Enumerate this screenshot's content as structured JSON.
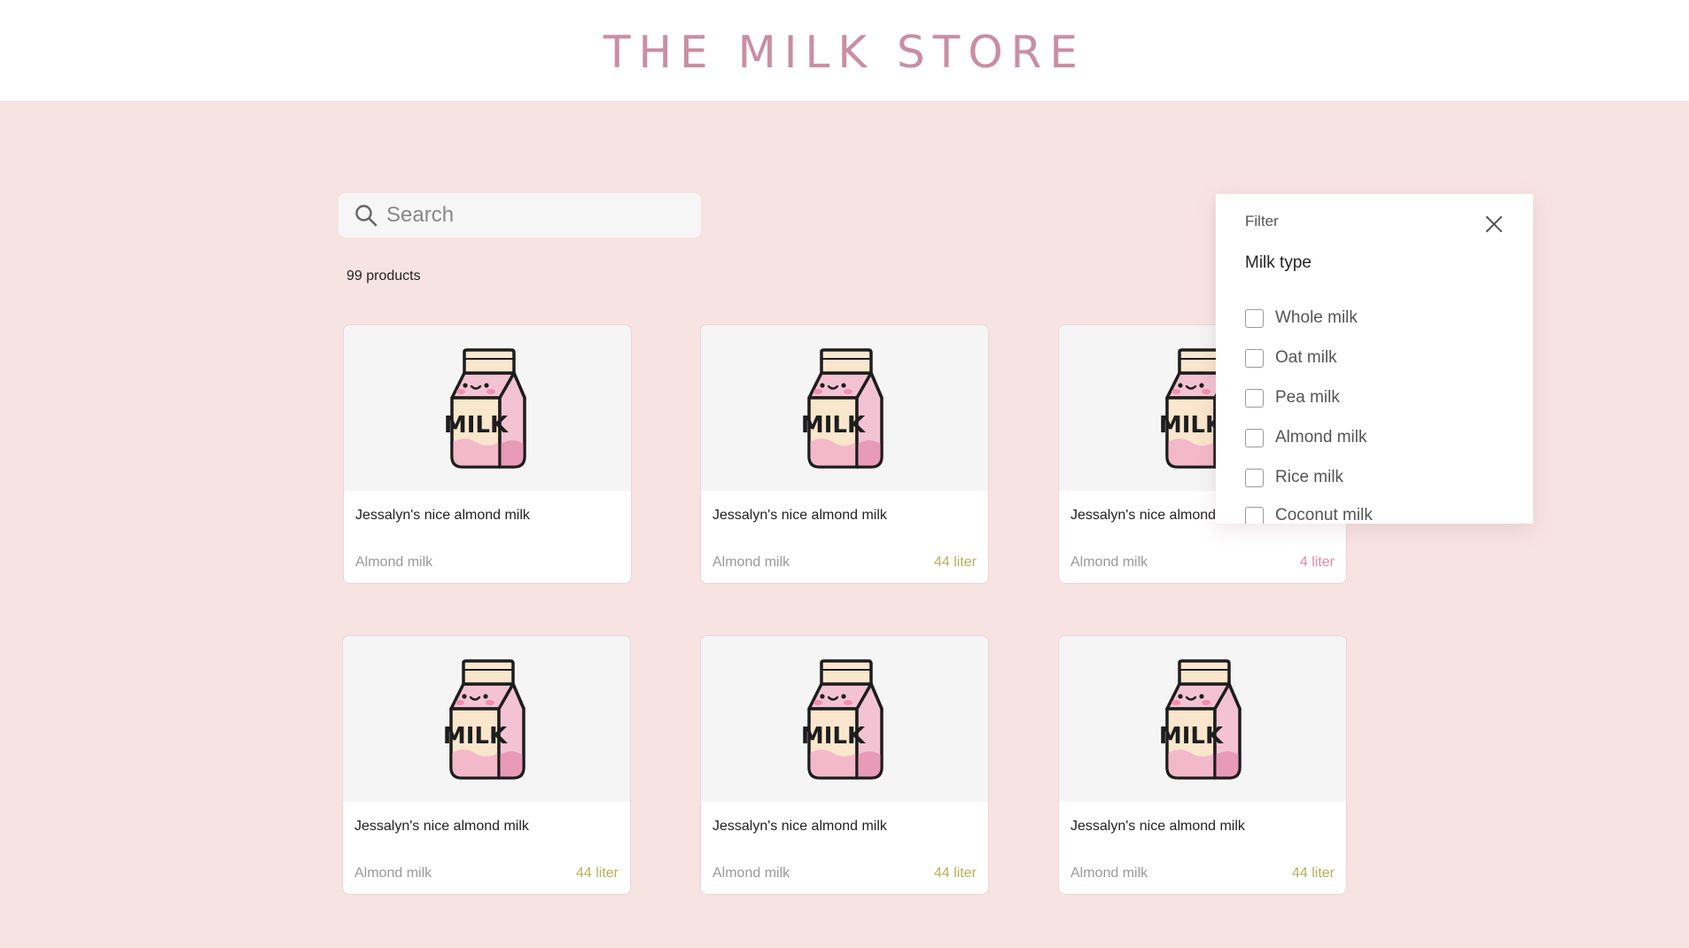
{
  "brand": {
    "title": "THE MILK STORE",
    "color": "#c98ea4"
  },
  "search": {
    "placeholder": "Search",
    "value": ""
  },
  "results": {
    "count_label": "99 products"
  },
  "product_image": {
    "icon": "milk-carton-icon",
    "label": "MILK"
  },
  "products": [
    {
      "name": "Jessalyn's nice almond milk",
      "type": "Almond milk",
      "volume": "",
      "volume_color": ""
    },
    {
      "name": "Jessalyn's nice almond milk",
      "type": "Almond milk",
      "volume": "44 liter",
      "volume_color": "#b3b15a"
    },
    {
      "name": "Jessalyn's nice almond milk",
      "type": "Almond milk",
      "volume": "4 liter",
      "volume_color": "#e08aa2"
    },
    {
      "name": "Jessalyn's nice almond milk",
      "type": "Almond milk",
      "volume": "44 liter",
      "volume_color": "#b3b15a"
    },
    {
      "name": "Jessalyn's nice almond milk",
      "type": "Almond milk",
      "volume": "44 liter",
      "volume_color": "#b3b15a"
    },
    {
      "name": "Jessalyn's nice almond milk",
      "type": "Almond milk",
      "volume": "44 liter",
      "volume_color": "#b3b15a"
    }
  ],
  "filter": {
    "label": "Filter",
    "close_icon": "close-icon",
    "section_title": "Milk type",
    "options": [
      {
        "label": "Whole milk",
        "checked": false
      },
      {
        "label": "Oat milk",
        "checked": false
      },
      {
        "label": "Pea milk",
        "checked": false
      },
      {
        "label": "Almond milk",
        "checked": false
      },
      {
        "label": "Rice milk",
        "checked": false
      },
      {
        "label": "Coconut milk",
        "checked": false
      }
    ]
  }
}
